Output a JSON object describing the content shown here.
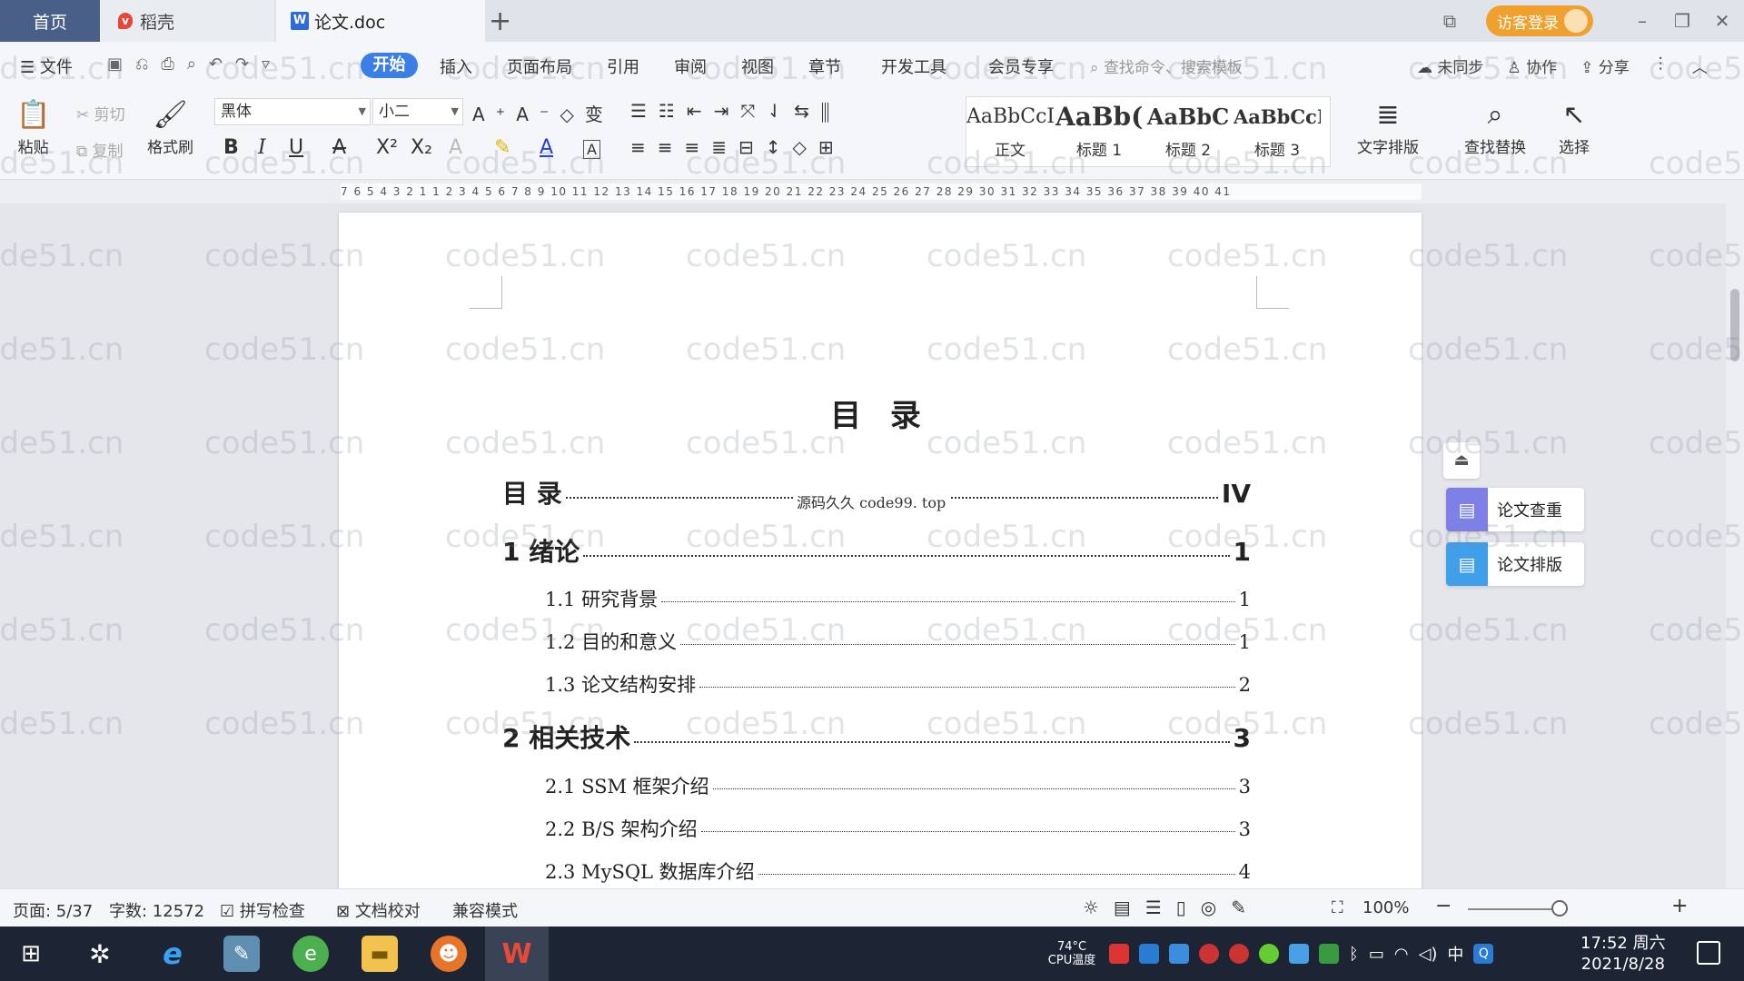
{
  "tabs": {
    "home": "首页",
    "daoke": "稻壳",
    "document": "论文.doc",
    "document_icon": "W",
    "add": "+"
  },
  "window": {
    "login": "访客登录",
    "minimize": "–",
    "restore": "❐",
    "close": "✕",
    "reader": "⧉"
  },
  "menu": {
    "file": "文件",
    "items": [
      "开始",
      "插入",
      "页面布局",
      "引用",
      "审阅",
      "视图",
      "章节",
      "开发工具",
      "会员专享"
    ],
    "search_placeholder": "查找命令、搜索模板",
    "sync": "未同步",
    "collab": "协作",
    "share": "分享"
  },
  "ribbon": {
    "paste": "粘贴",
    "cut": "剪切",
    "copy": "复制",
    "format_painter": "格式刷",
    "font_name": "黑体",
    "font_size": "小二",
    "styles": [
      {
        "sample": "AaBbCcI",
        "label": "正文"
      },
      {
        "sample": "AaBb(",
        "label": "标题 1"
      },
      {
        "sample": "AaBbC",
        "label": "标题 2"
      },
      {
        "sample": "AaBbCcI",
        "label": "标题 3"
      }
    ],
    "text_layout": "文字排版",
    "find_replace": "查找替换",
    "select": "选择"
  },
  "ruler": "7 6 5 4 3 2 1   1 2 3 4 5 6 7 8 9 10 11 12 13 14 15 16 17 18 19 20 21 22 23 24 25 26 27 28 29 30 31 32 33 34 35 36 37 38 39 40 41",
  "document": {
    "toc_title": "目 录",
    "overlay": "源码久久 code99. top",
    "entries": [
      {
        "level": 1,
        "text": "目 录",
        "page": "IV"
      },
      {
        "level": 1,
        "text": "1  绪论",
        "page": "1"
      },
      {
        "level": 2,
        "text": "1.1  研究背景",
        "page": "1"
      },
      {
        "level": 2,
        "text": "1.2 目的和意义",
        "page": "1"
      },
      {
        "level": 2,
        "text": "1.3  论文结构安排",
        "page": "2"
      },
      {
        "level": 1,
        "text": "2  相关技术",
        "page": "3"
      },
      {
        "level": 2,
        "text": "2.1 SSM 框架介绍",
        "page": "3"
      },
      {
        "level": 2,
        "text": "2.2 B/S 架构介绍",
        "page": "3"
      },
      {
        "level": 2,
        "text": "2.3 MySQL 数据库介绍",
        "page": "4"
      }
    ]
  },
  "side_panel": {
    "check": "论文查重",
    "layout": "论文排版"
  },
  "watermark": "code51.cn",
  "status": {
    "page": "页面: 5/37",
    "words": "字数: 12572",
    "spell": "拼写检查",
    "proof": "文档校对",
    "compat": "兼容模式",
    "zoom": "100%"
  },
  "taskbar": {
    "temp": "74°C",
    "cpu": "CPU温度",
    "ime": "中",
    "time": "17:52 周六",
    "date": "2021/8/28"
  },
  "colors": {
    "accent": "#3a7ee6",
    "login": "#f0a02e",
    "home_tab": "#4a5f88",
    "side_check": "#7d80e6",
    "side_layout": "#3f9fe8"
  }
}
